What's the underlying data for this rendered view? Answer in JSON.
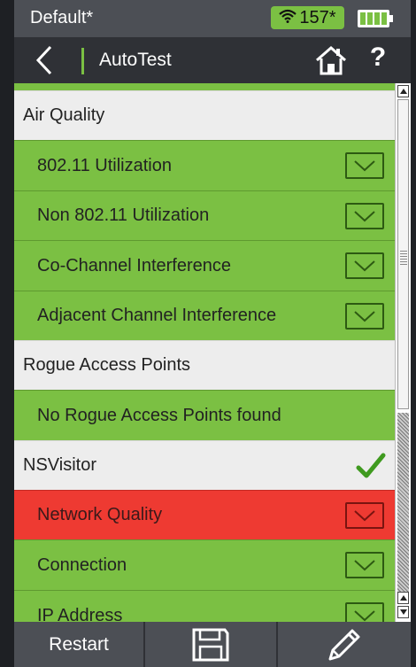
{
  "statusbar": {
    "profile": "Default*",
    "wifi_count": "157*",
    "colors": {
      "ok_green": "#7bc043",
      "fail_red": "#ee3a32"
    }
  },
  "titlebar": {
    "title": "AutoTest",
    "help": "?"
  },
  "list": {
    "sections": [
      {
        "type": "header",
        "label": "Air Quality"
      },
      {
        "type": "pass",
        "label": "802.11 Utilization"
      },
      {
        "type": "pass",
        "label": "Non 802.11 Utilization"
      },
      {
        "type": "pass",
        "label": "Co-Channel Interference"
      },
      {
        "type": "pass",
        "label": "Adjacent Channel Interference"
      },
      {
        "type": "header",
        "label": "Rogue Access Points"
      },
      {
        "type": "pass",
        "label": "No Rogue Access Points found"
      },
      {
        "type": "header",
        "label": "NSVisitor"
      },
      {
        "type": "fail",
        "label": "Network Quality"
      },
      {
        "type": "pass",
        "label": "Connection"
      },
      {
        "type": "pass",
        "label": "IP Address"
      }
    ]
  },
  "toolbar": {
    "restart_label": "Restart"
  },
  "icons": {
    "back": "chevron-left-icon",
    "home": "home-icon",
    "expand": "chevron-down-icon",
    "check": "checkmark-icon",
    "save": "floppy-disk-icon",
    "edit": "pencil-icon"
  }
}
